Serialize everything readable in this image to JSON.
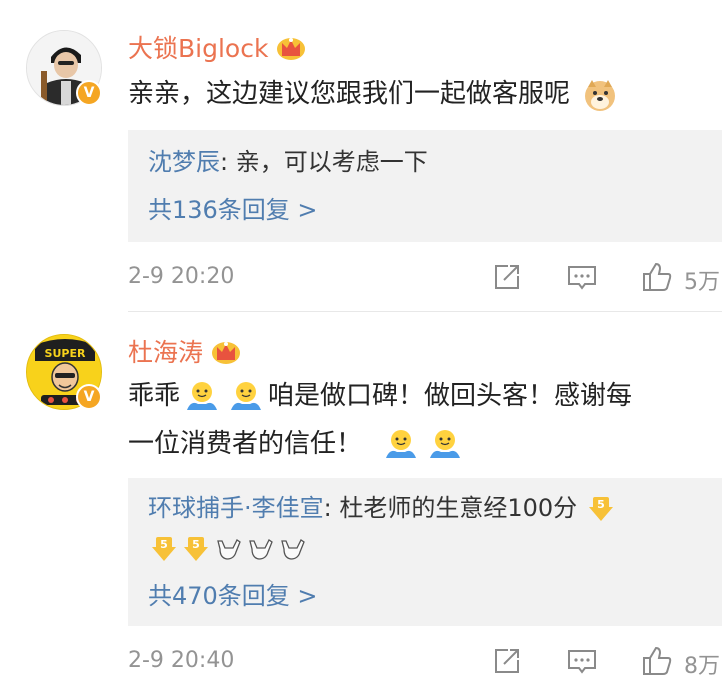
{
  "comments": [
    {
      "username": "大锁Biglock",
      "text": "亲亲，这边建议您跟我们一起做客服呢",
      "reply_preview": {
        "author": "沈梦辰",
        "text": "亲，可以考虑一下"
      },
      "reply_count_label": "共136条回复 >",
      "timestamp": "2-9 20:20",
      "like_count": "5万"
    },
    {
      "username": "杜海涛",
      "text_line1": "乖乖",
      "text_line1b": "咱是做口碑！做回头客！感谢每",
      "text_line2": "一位消费者的信任！",
      "avatar_text": "SUPER",
      "reply_preview": {
        "author": "环球捕手·李佳宣",
        "text": "杜老师的生意经100分"
      },
      "reply_count_label": "共470条回复 >",
      "timestamp": "2-9 20:40",
      "like_count": "8万"
    }
  ],
  "icons": {
    "verified": "V",
    "crown": "crown-icon",
    "share": "share-icon",
    "comment": "comment-icon",
    "like": "thumbs-up-icon"
  },
  "colors": {
    "username": "#eb7350",
    "reply_author": "#507daf",
    "meta": "#939393",
    "reply_bg": "#f2f2f2",
    "verified": "#f5a623"
  }
}
